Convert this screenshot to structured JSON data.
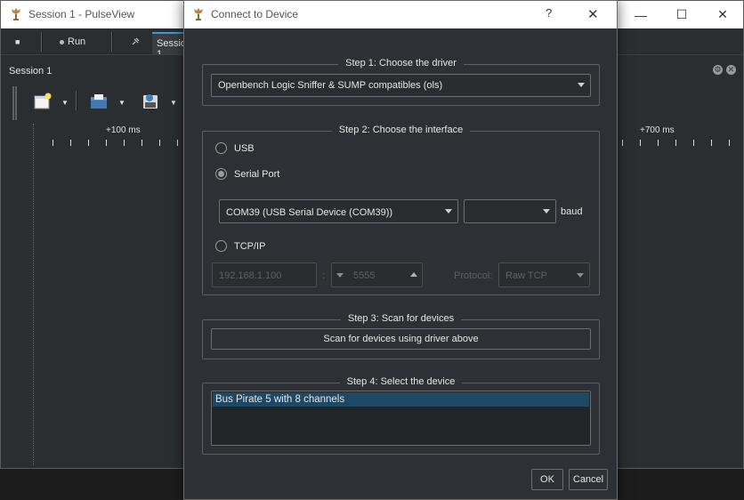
{
  "main_window": {
    "title": "Session 1 - PulseView",
    "controls": {
      "minimize": "—",
      "maximize": "☐",
      "close": "✕"
    },
    "toolbar": {
      "stop_icon": "■",
      "run_label": "Run",
      "session_tab": "Session 1"
    },
    "session_label": "Session 1",
    "ruler_labels": [
      "+100 ms",
      "+700 ms"
    ]
  },
  "dialog": {
    "title": "Connect to Device",
    "help": "?",
    "close": "✕",
    "step1": {
      "title": "Step 1: Choose the driver",
      "driver_value": "Openbench Logic Sniffer & SUMP compatibles (ols)"
    },
    "step2": {
      "title": "Step 2: Choose the interface",
      "usb_label": "USB",
      "serial_label": "Serial Port",
      "serial_selected": true,
      "port_value": "COM39 (USB Serial Device (COM39))",
      "baud_value": "",
      "baud_label": "baud",
      "tcp_label": "TCP/IP",
      "tcp_host": "192.168.1.100",
      "tcp_sep": ":",
      "tcp_port": "5555",
      "protocol_label": "Protocol:",
      "protocol_value": "Raw TCP"
    },
    "step3": {
      "title": "Step 3: Scan for devices",
      "scan_button": "Scan for devices using driver above"
    },
    "step4": {
      "title": "Step 4: Select the device",
      "devices": [
        "Bus Pirate 5 with 8 channels"
      ]
    },
    "ok_button": "OK",
    "cancel_button": "Cancel"
  },
  "colors": {
    "window_bg": "#2b2e31",
    "dialog_bg": "#2d3034",
    "accent": "#3c9bd6",
    "selection": "#1f4864",
    "text": "#e6e6e6",
    "disabled_text": "#5d6064"
  }
}
